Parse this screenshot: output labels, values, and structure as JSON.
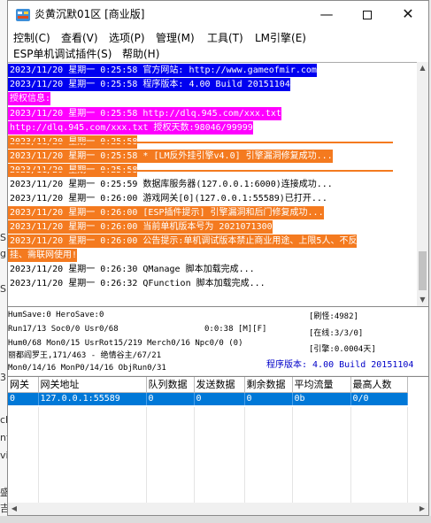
{
  "window": {
    "title": "炎黄沉默01区 [商业版]",
    "min_glyph": "—",
    "close_glyph": "✕"
  },
  "menu": [
    "控制(C)",
    "查看(V)",
    "选项(P)",
    "管理(M)",
    "工具(T)",
    "LM引擎(E)",
    "ESP单机调试插件(S)",
    "帮助(H)"
  ],
  "log": [
    {
      "text": "2023/11/20 星期一 0:25:58 官方网站: http://www.gameofmir.com",
      "style": "blue"
    },
    {
      "text": "2023/11/20 星期一 0:25:58 程序版本: 4.00 Build 20151104",
      "style": "blue"
    },
    {
      "text": "授权信息:",
      "style": "magenta"
    },
    {
      "text": "2023/11/20 星期一 0:25:58 http://dlq.945.com/xxx.txt",
      "style": "magenta"
    },
    {
      "text": "http://dlq.945.com/xxx.txt 授权天数:98046/99999",
      "style": "magenta"
    },
    {
      "text": "2023/11/20 星期一 0:25:58",
      "style": "orange"
    },
    {
      "text": "2023/11/20 星期一 0:25:58 * [LM反外挂引擎v4.0] 引擎漏洞修复成功...",
      "style": "orange"
    },
    {
      "text": "2023/11/20 星期一 0:25:58",
      "style": "orange"
    },
    {
      "text": "2023/11/20 星期一 0:25:59 数据库服务器(127.0.0.1:6000)连接成功...",
      "style": "plain"
    },
    {
      "text": "2023/11/20 星期一 0:26:00 游戏网关[0](127.0.0.1:55589)已打开...",
      "style": "plain"
    },
    {
      "text": "2023/11/20 星期一 0:26:00 [ESP插件提示] 引擎漏洞和后门修复成功...",
      "style": "orange"
    },
    {
      "text": "2023/11/20 星期一 0:26:00 当前单机版本号为 2021071300",
      "style": "orange"
    },
    {
      "text": "2023/11/20 星期一 0:26:00 公告提示:单机调试版本禁止商业用途、上限5人、不反",
      "style": "orange"
    },
    {
      "text": "挂、需联网使用!",
      "style": "orange"
    },
    {
      "text": "2023/11/20 星期一 0:26:30 QManage 脚本加载完成...",
      "style": "plain"
    },
    {
      "text": "2023/11/20 星期一 0:26:32 QFunction 脚本加载完成...",
      "style": "plain"
    }
  ],
  "stats": {
    "line1": "HumSave:0 HeroSave:0",
    "line2": "Run17/13 Soc0/0 Usr0/68",
    "timer": "0:0:38 [M][F]",
    "line3": "Hum0/68 Mon0/15 UsrRot15/219 Merch0/16 Npc0/0 (0)",
    "line4": "丽都阎罗王,171/463 - 绝情谷主/67/21",
    "line5": "Mon0/14/16 MonP0/14/16 ObjRun0/31",
    "refresh": "[刷怪:4982]",
    "online": "[在线:3/3/0]",
    "engine": "[引擎:0.0004天]",
    "version": "程序版本: 4.00 Build 20151104"
  },
  "table": {
    "headers": [
      "网关",
      "网关地址",
      "队列数据",
      "发送数据",
      "剩余数据",
      "平均流量",
      "最高人数"
    ],
    "rows": [
      [
        "0",
        "127.0.0.1:55589",
        "0",
        "0",
        "0",
        "0b",
        "0/0"
      ]
    ]
  },
  "bg_left_glyphs": [
    "S",
    "gi",
    "S",
    "3",
    "ck",
    "nf",
    "vil",
    "盛",
    "吉"
  ]
}
